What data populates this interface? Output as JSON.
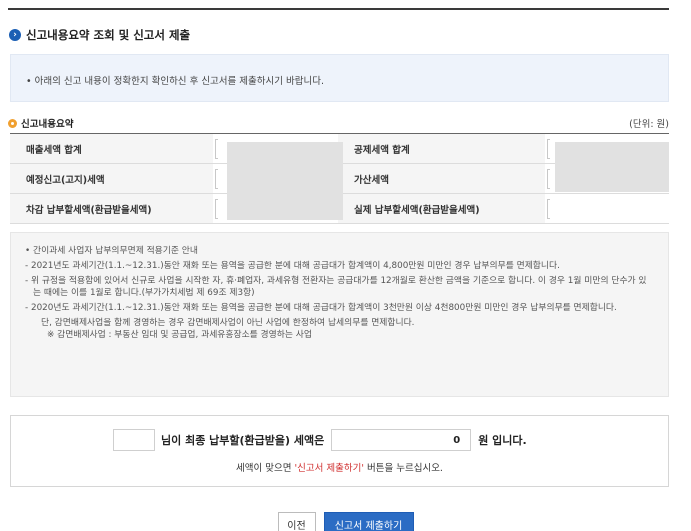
{
  "page": {
    "title": "신고내용요약 조회 및 신고서 제출",
    "notice": "• 아래의 신고 내용이 정확한지 확인하신 후 신고서를 제출하시기 바랍니다."
  },
  "summary": {
    "title": "신고내용요약",
    "unit": "(단위: 원)",
    "rows": [
      {
        "left_label": "매출세액 합계",
        "right_label": "공제세액 합계"
      },
      {
        "left_label": "예정신고(고지)세액",
        "right_label": "가산세액"
      },
      {
        "left_label": "차감 납부할세액(환급받을세액)",
        "right_label": "실제 납부할세액(환급받을세액)"
      }
    ]
  },
  "info": {
    "heading": "• 간이과세 사업자 납부의무면제 적용기준 안내",
    "items": [
      "- 2021년도 과세기간(1.1.~12.31.)동안 재화 또는 용역을 공급한 분에 대해 공급대가 합계액이 4,800만원 미만인 경우 납부의무를 면제합니다.",
      "- 위 규정을 적용함에 있어서 신규로 사업을 시작한 자, 휴·폐업자, 과세유형 전환자는 공급대가를 12개월로 환산한 금액을 기준으로 합니다. 이 경우 1월 미만의 단수가 있는 때에는 이를 1월로 합니다.(부가가치세법 제 69조 제3항)",
      "- 2020년도 과세기간(1.1.~12.31.)동안 재화 또는 용역을 공급한 분에 대해 공급대가 합계액이 3천만원 이상 4천800만원 미만인 경우 납부의무를 면제합니다."
    ],
    "sub1": "단, 감면배제사업을 함께 경영하는 경우 감면배제사업이 아닌 사업에 한정하여 납세의무를 면제합니다.",
    "sub2": "※ 감면배제사업 : 부동산 임대 및 공급업, 과세유흥장소를 경영하는 사업"
  },
  "final": {
    "name_suffix": "님이 최종 납부할(환급받을) 세액은",
    "amount": "0",
    "unit_suffix": "원 입니다.",
    "sub_pre": "세액이 맞으면 ",
    "sub_em": "'신고서 제출하기'",
    "sub_post": " 버튼을 누르십시오."
  },
  "buttons": {
    "prev": "이전",
    "submit": "신고서 제출하기"
  },
  "colors": {
    "accent": "#2b6cc4",
    "title_bullet": "#1b5fb4",
    "section_dot": "#f0a030",
    "emphasis": "#d03030"
  }
}
